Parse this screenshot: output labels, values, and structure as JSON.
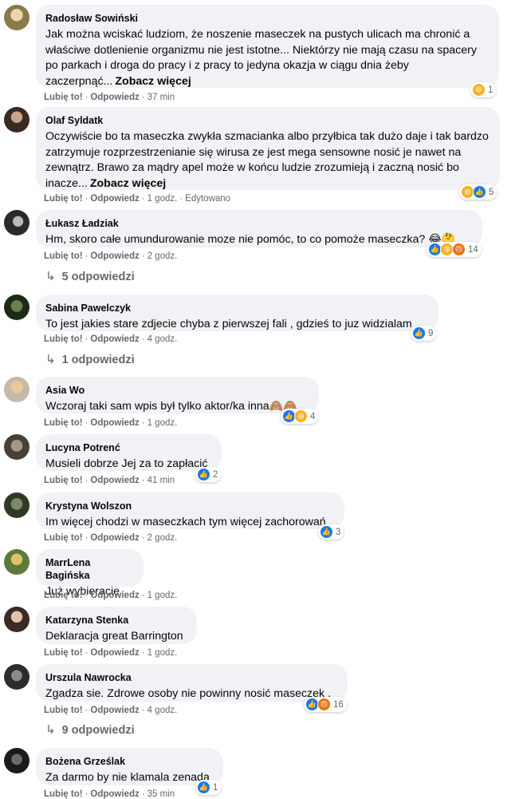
{
  "labels": {
    "like": "Lubię to!",
    "reply": "Odpowiedz",
    "see_more": "Zobacz więcej",
    "edited": "Edytowano"
  },
  "colors": {
    "bubble": "#f0f2f5",
    "meta": "#65676b",
    "like_icon": "#1877f2",
    "haha_icon": "#f7b125",
    "angry_icon": "#e9710f"
  },
  "comments": [
    {
      "author": "Radosław Sowiński",
      "text": "Jak można wciskać ludziom, że noszenie maseczek na pustych ulicach ma chronić a właściwe dotlenienie organizmu nie jest istotne... Niektórzy nie mają czasu na spacery po parkach i droga do pracy i z pracy to jedyna okazja w ciągu dnia żeby zaczerpnąć...",
      "time": "37 min",
      "reactions": {
        "icons": [
          "haha-icon"
        ],
        "count": "1"
      }
    },
    {
      "author": "Olaf Syldatk",
      "text": "Oczywiście bo ta maseczka zwykła szmacianka albo przyłbica tak dużo daje i tak bardzo zatrzymuje rozprzestrzenianie się wirusa ze jest mega sensowne nosić je nawet na zewnątrz. Brawo za mądry apel może w końcu ludzie zrozumieją i zaczną nosić bo inacze...",
      "time": "1 godz.",
      "reactions": {
        "icons": [
          "haha-icon",
          "like-icon"
        ],
        "count": "5"
      }
    },
    {
      "author": "Łukasz Ładziak",
      "text": "Hm, skoro całe umundurowanie moze nie pomóc, to co pomoże maseczka? 😂🤔",
      "time": "2 godz.",
      "reactions": {
        "icons": [
          "like-icon",
          "haha-icon",
          "angry-icon"
        ],
        "count": "14"
      },
      "replies": "5 odpowiedzi"
    },
    {
      "author": "Sabina Pawelczyk",
      "text": "To jest jakies stare zdjecie chyba z pierwszej fali , gdzieś to juz widzialam .",
      "time": "4 godz.",
      "reactions": {
        "icons": [
          "like-icon"
        ],
        "count": "9"
      },
      "replies": "1 odpowiedzi"
    },
    {
      "author": "Asia Wo",
      "text": "Wczoraj taki sam wpis był tylko aktor/ka inna🙈🙈",
      "time": "1 godz.",
      "reactions": {
        "icons": [
          "like-icon",
          "haha-icon"
        ],
        "count": "4"
      }
    },
    {
      "author": "Lucyna Potrenć",
      "text": "Musieli dobrze Jej za to zapłacić",
      "time": "41 min",
      "reactions": {
        "icons": [
          "like-icon"
        ],
        "count": "2"
      }
    },
    {
      "author": "Krystyna Wolszon",
      "text": "Im więcej chodzi w maseczkach tym więcej zachorowań",
      "time": "2 godz.",
      "reactions": {
        "icons": [
          "like-icon"
        ],
        "count": "3"
      }
    },
    {
      "author": "MarrLena Bagińska",
      "text": "Już wybieracie",
      "time": "1 godz."
    },
    {
      "author": "Katarzyna Stenka",
      "text": "Deklaracja great Barrington",
      "time": "1 godz."
    },
    {
      "author": "Urszula Nawrocka",
      "text": "Zgadza sie. Zdrowe osoby nie powinny nosić maseczek .",
      "time": "4 godz.",
      "reactions": {
        "icons": [
          "like-icon",
          "angry-icon"
        ],
        "count": "16"
      },
      "replies": "9 odpowiedzi"
    },
    {
      "author": "Bożena Grześlak",
      "text": "Za darmo by nie klamala zenada",
      "time": "35 min",
      "reactions": {
        "icons": [
          "like-icon"
        ],
        "count": "1"
      }
    }
  ]
}
